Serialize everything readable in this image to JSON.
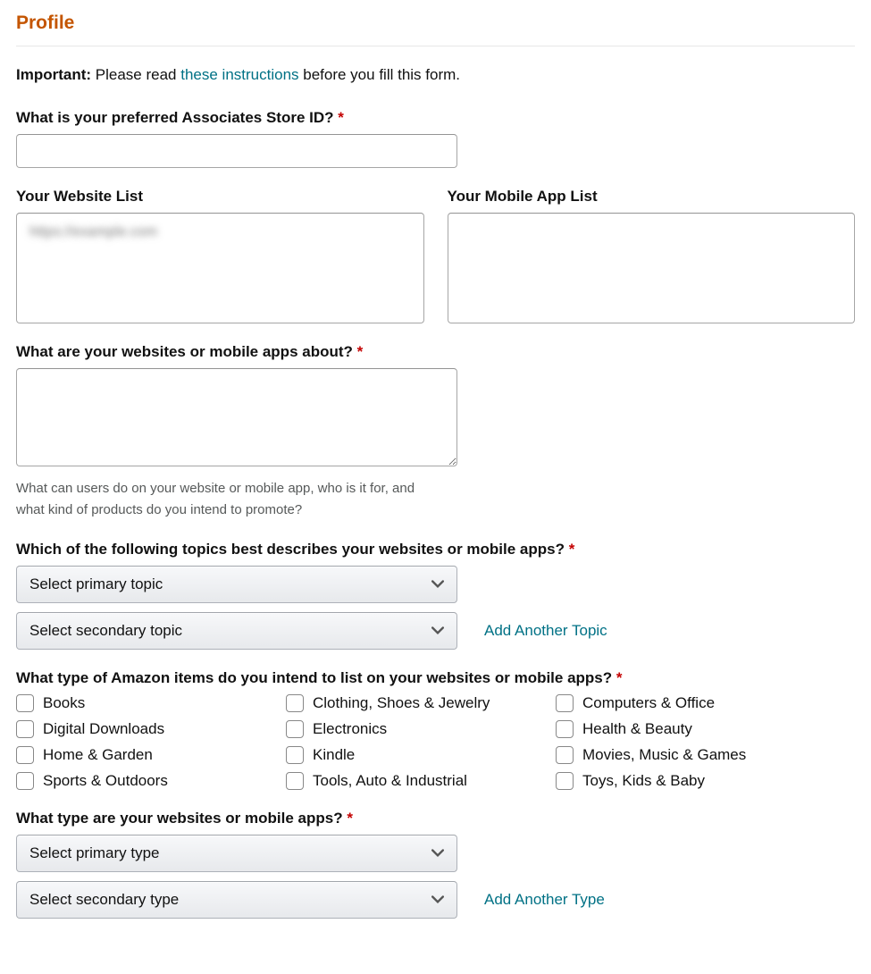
{
  "header": {
    "title": "Profile"
  },
  "important": {
    "label": "Important:",
    "before_link": "Please read ",
    "link_text": "these instructions",
    "after_link": " before you fill this form."
  },
  "store_id": {
    "label": "What is your preferred Associates Store ID? ",
    "value": ""
  },
  "lists": {
    "website_label": "Your Website List",
    "website_value": "https://example.com",
    "mobile_label": "Your Mobile App List",
    "mobile_value": ""
  },
  "about": {
    "label": "What are your websites or mobile apps about? ",
    "value": "",
    "help": "What can users do on your website or mobile app, who is it for, and what kind of products do you intend to promote?"
  },
  "topics": {
    "label": "Which of the following topics best describes your websites or mobile apps? ",
    "primary": "Select primary topic",
    "secondary": "Select secondary topic",
    "add_another": "Add Another Topic"
  },
  "items": {
    "label": "What type of Amazon items do you intend to list on your websites or mobile apps? ",
    "options": [
      "Books",
      "Clothing, Shoes & Jewelry",
      "Computers & Office",
      "Digital Downloads",
      "Electronics",
      "Health & Beauty",
      "Home & Garden",
      "Kindle",
      "Movies, Music & Games",
      "Sports & Outdoors",
      "Tools, Auto & Industrial",
      "Toys, Kids & Baby"
    ]
  },
  "types": {
    "label": "What type are your websites or mobile apps? ",
    "primary": "Select primary type",
    "secondary": "Select secondary type",
    "add_another": "Add Another Type"
  },
  "required_marker": "*"
}
